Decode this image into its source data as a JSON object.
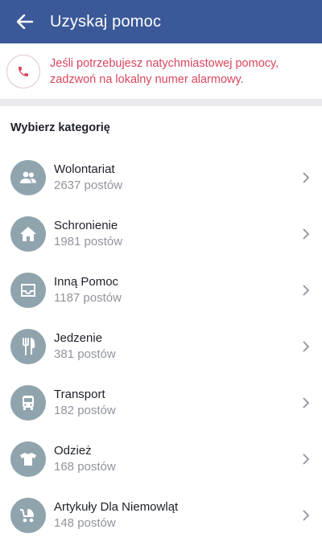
{
  "header": {
    "title": "Uzyskaj pomoc",
    "back_icon": "arrow-left-icon"
  },
  "alert": {
    "text": "Jeśli potrzebujesz natychmiastowej pomocy, zadzwoń na lokalny numer alarmowy.",
    "icon": "phone-icon",
    "color": "#d9465f"
  },
  "section": {
    "title": "Wybierz kategorię"
  },
  "categories": [
    {
      "title": "Wolontariat",
      "count": "2637 postów",
      "icon": "people-icon"
    },
    {
      "title": "Schronienie",
      "count": "1981 postów",
      "icon": "house-icon"
    },
    {
      "title": "Inną Pomoc",
      "count": "1187 postów",
      "icon": "tray-icon"
    },
    {
      "title": "Jedzenie",
      "count": "381 postów",
      "icon": "fork-knife-icon"
    },
    {
      "title": "Transport",
      "count": "182 postów",
      "icon": "bus-icon"
    },
    {
      "title": "Odzież",
      "count": "168 postów",
      "icon": "shirt-icon"
    },
    {
      "title": "Artykuły Dla Niemowląt",
      "count": "148 postów",
      "icon": "stroller-icon"
    }
  ],
  "colors": {
    "brand": "#3b5998",
    "icon_bg": "#90a4ae"
  }
}
